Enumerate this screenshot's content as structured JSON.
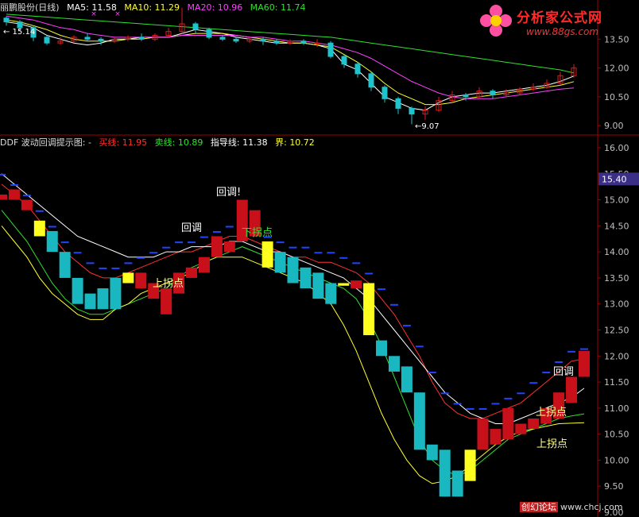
{
  "header_top": {
    "name": "丽鹏股份(日线)",
    "ma5_label": "MA5:",
    "ma5": "11.58",
    "ma10_label": "MA10:",
    "ma10": "11.29",
    "ma20_label": "MA20:",
    "ma20": "10.96",
    "ma60_label": "MA60:",
    "ma60": "11.74"
  },
  "header_bottom": {
    "name": "DDF 波动回调提示图: -",
    "buy_label": "买线:",
    "buy": "11.95",
    "sell_label": "卖线:",
    "sell": "10.89",
    "guide_label": "指导线:",
    "guide": "11.38",
    "bound_label": "界:",
    "bound": "10.72"
  },
  "logo": {
    "main": "分析家公式网",
    "sub": "www.88gs.com"
  },
  "watermark": {
    "a": "创幻论坛",
    "b": "www.chcj.com"
  },
  "colors": {
    "up": "#dd1b1b",
    "down": "#1ec3cc",
    "ma5": "#ffffff",
    "ma10": "#ffff30",
    "ma20": "#ff40ff",
    "ma60": "#30e030",
    "axis": "#a00000",
    "current_bg": "#3a2e86"
  },
  "chart_data": [
    {
      "type": "line",
      "panel": "price-candles",
      "ylim": [
        8.8,
        14.3
      ],
      "yticks": [
        "13.50",
        "12.00",
        "10.50",
        "9.00"
      ],
      "annotations": [
        "15.14",
        "9.07"
      ],
      "series": [
        {
          "name": "MA5",
          "values": [
            14.4,
            14.3,
            14.1,
            13.7,
            13.5,
            13.3,
            13.2,
            13.3,
            13.5,
            13.5,
            13.6,
            13.6,
            13.6,
            13.8,
            14.0,
            13.9,
            13.8,
            13.6,
            13.5,
            13.4,
            13.3,
            13.3,
            13.3,
            13.2,
            13.0,
            12.2,
            11.9,
            11.2,
            10.5,
            10.2,
            9.9,
            9.8,
            10.2,
            10.5,
            10.6,
            10.7,
            10.7,
            10.8,
            10.9,
            11.0,
            11.1,
            11.3,
            11.58
          ]
        },
        {
          "name": "MA10",
          "values": [
            14.5,
            14.4,
            14.2,
            14.0,
            13.7,
            13.5,
            13.4,
            13.4,
            13.4,
            13.5,
            13.5,
            13.6,
            13.6,
            13.7,
            13.8,
            13.8,
            13.8,
            13.7,
            13.6,
            13.5,
            13.4,
            13.3,
            13.3,
            13.2,
            13.1,
            12.7,
            12.3,
            11.8,
            11.2,
            10.7,
            10.4,
            10.1,
            10.1,
            10.2,
            10.4,
            10.5,
            10.6,
            10.7,
            10.8,
            10.9,
            11.0,
            11.1,
            11.29
          ]
        },
        {
          "name": "MA20",
          "values": [
            14.7,
            14.6,
            14.5,
            14.3,
            14.1,
            14.0,
            13.8,
            13.7,
            13.6,
            13.6,
            13.6,
            13.6,
            13.6,
            13.7,
            13.7,
            13.7,
            13.7,
            13.7,
            13.6,
            13.6,
            13.5,
            13.4,
            13.4,
            13.3,
            13.2,
            13.0,
            12.8,
            12.5,
            12.1,
            11.7,
            11.3,
            11.0,
            10.7,
            10.5,
            10.4,
            10.4,
            10.4,
            10.5,
            10.6,
            10.7,
            10.8,
            10.9,
            10.96
          ]
        },
        {
          "name": "MA60",
          "values": [
            14.8,
            14.75,
            14.7,
            14.65,
            14.6,
            14.55,
            14.5,
            14.45,
            14.4,
            14.35,
            14.3,
            14.25,
            14.2,
            14.15,
            14.1,
            14.05,
            14.0,
            13.95,
            13.9,
            13.85,
            13.8,
            13.75,
            13.7,
            13.65,
            13.6,
            13.5,
            13.4,
            13.3,
            13.2,
            13.1,
            13.0,
            12.9,
            12.8,
            12.7,
            12.6,
            12.5,
            12.4,
            12.3,
            12.2,
            12.1,
            12.0,
            11.9,
            11.74
          ]
        }
      ],
      "candles": [
        [
          14.6,
          14.4,
          14.7,
          14.2
        ],
        [
          14.4,
          14.1,
          14.5,
          13.9
        ],
        [
          14.1,
          13.6,
          14.2,
          13.4
        ],
        [
          13.6,
          13.3,
          13.7,
          13.2
        ],
        [
          13.3,
          13.4,
          13.6,
          13.2
        ],
        [
          13.4,
          13.6,
          13.7,
          13.3
        ],
        [
          13.6,
          13.5,
          13.8,
          13.4
        ],
        [
          13.5,
          13.4,
          13.6,
          13.2
        ],
        [
          13.4,
          13.5,
          13.6,
          13.3
        ],
        [
          13.5,
          13.6,
          13.7,
          13.4
        ],
        [
          13.6,
          13.5,
          13.8,
          13.4
        ],
        [
          13.5,
          13.7,
          13.8,
          13.4
        ],
        [
          13.7,
          13.9,
          14.1,
          13.6
        ],
        [
          13.9,
          14.3,
          15.14,
          13.8
        ],
        [
          14.3,
          14.0,
          14.4,
          13.8
        ],
        [
          14.0,
          13.6,
          14.1,
          13.5
        ],
        [
          13.6,
          13.5,
          13.7,
          13.4
        ],
        [
          13.5,
          13.4,
          13.6,
          13.3
        ],
        [
          13.4,
          13.5,
          13.6,
          13.3
        ],
        [
          13.5,
          13.4,
          13.6,
          13.2
        ],
        [
          13.4,
          13.3,
          13.5,
          13.2
        ],
        [
          13.3,
          13.4,
          13.5,
          13.2
        ],
        [
          13.4,
          13.3,
          13.5,
          13.2
        ],
        [
          13.3,
          13.3,
          13.5,
          13.1
        ],
        [
          13.3,
          12.6,
          13.4,
          12.5
        ],
        [
          12.6,
          12.2,
          12.7,
          12.0
        ],
        [
          12.2,
          11.7,
          12.3,
          11.5
        ],
        [
          11.7,
          11.0,
          11.8,
          10.8
        ],
        [
          11.0,
          10.4,
          11.1,
          10.2
        ],
        [
          10.4,
          9.9,
          10.5,
          9.6
        ],
        [
          9.9,
          9.6,
          10.0,
          9.07
        ],
        [
          9.6,
          9.8,
          10.0,
          9.3
        ],
        [
          9.8,
          10.3,
          10.5,
          9.7
        ],
        [
          10.3,
          10.6,
          10.8,
          10.2
        ],
        [
          10.6,
          10.5,
          10.7,
          10.3
        ],
        [
          10.5,
          10.8,
          11.0,
          10.4
        ],
        [
          10.8,
          10.6,
          10.9,
          10.4
        ],
        [
          10.6,
          10.7,
          10.9,
          10.5
        ],
        [
          10.7,
          10.9,
          11.0,
          10.6
        ],
        [
          10.9,
          11.0,
          11.2,
          10.8
        ],
        [
          11.0,
          11.2,
          11.4,
          10.9
        ],
        [
          11.2,
          11.6,
          11.8,
          11.1
        ],
        [
          11.6,
          12.0,
          12.2,
          11.5
        ]
      ]
    },
    {
      "type": "bar",
      "panel": "ddf-indicator",
      "ylim": [
        9.0,
        16.2
      ],
      "yticks": [
        "16.00",
        "15.50",
        "15.00",
        "14.50",
        "14.00",
        "13.50",
        "13.00",
        "12.50",
        "12.00",
        "11.50",
        "11.00",
        "10.50",
        "10.00",
        "9.50",
        "9.00"
      ],
      "current_value": "15.40",
      "annotations": [
        "回调!",
        "回调",
        "下拐点",
        "上拐点",
        "回调",
        "上拐点",
        "上拐点"
      ],
      "blocks": [
        {
          "c": "up",
          "v": [
            15.1,
            15.0
          ]
        },
        {
          "c": "up",
          "v": [
            15.2,
            15.0
          ]
        },
        {
          "c": "up",
          "v": [
            15.0,
            14.8
          ]
        },
        {
          "c": "yellow",
          "v": [
            14.6,
            14.3
          ]
        },
        {
          "c": "down",
          "v": [
            14.4,
            14.0
          ]
        },
        {
          "c": "down",
          "v": [
            14.0,
            13.5
          ]
        },
        {
          "c": "down",
          "v": [
            13.5,
            13.0
          ]
        },
        {
          "c": "down",
          "v": [
            13.2,
            12.9
          ]
        },
        {
          "c": "down",
          "v": [
            13.3,
            12.9
          ]
        },
        {
          "c": "down",
          "v": [
            13.5,
            12.9
          ]
        },
        {
          "c": "yellow",
          "v": [
            13.6,
            13.4
          ]
        },
        {
          "c": "up",
          "v": [
            13.6,
            13.3
          ]
        },
        {
          "c": "up",
          "v": [
            13.4,
            13.1
          ]
        },
        {
          "c": "up",
          "v": [
            13.3,
            12.8
          ]
        },
        {
          "c": "up",
          "v": [
            13.6,
            13.2
          ]
        },
        {
          "c": "up",
          "v": [
            13.7,
            13.5
          ]
        },
        {
          "c": "up",
          "v": [
            13.9,
            13.6
          ]
        },
        {
          "c": "up",
          "v": [
            14.3,
            13.9
          ]
        },
        {
          "c": "up",
          "v": [
            14.2,
            14.0
          ]
        },
        {
          "c": "up",
          "v": [
            15.0,
            14.2
          ]
        },
        {
          "c": "up",
          "v": [
            14.8,
            14.3
          ]
        },
        {
          "c": "yellow",
          "v": [
            14.2,
            13.7
          ]
        },
        {
          "c": "down",
          "v": [
            14.0,
            13.6
          ]
        },
        {
          "c": "down",
          "v": [
            13.9,
            13.4
          ]
        },
        {
          "c": "down",
          "v": [
            13.7,
            13.3
          ]
        },
        {
          "c": "down",
          "v": [
            13.6,
            13.1
          ]
        },
        {
          "c": "down",
          "v": [
            13.4,
            13.0
          ]
        },
        {
          "c": "yellow",
          "v": [
            13.4,
            13.35
          ]
        },
        {
          "c": "up",
          "v": [
            13.45,
            13.3
          ]
        },
        {
          "c": "yellow",
          "v": [
            13.4,
            12.4
          ]
        },
        {
          "c": "down",
          "v": [
            12.3,
            12.0
          ]
        },
        {
          "c": "down",
          "v": [
            12.0,
            11.7
          ]
        },
        {
          "c": "down",
          "v": [
            11.8,
            11.3
          ]
        },
        {
          "c": "down",
          "v": [
            11.3,
            10.2
          ]
        },
        {
          "c": "down",
          "v": [
            10.3,
            10.0
          ]
        },
        {
          "c": "down",
          "v": [
            10.2,
            9.3
          ]
        },
        {
          "c": "down",
          "v": [
            9.8,
            9.3
          ]
        },
        {
          "c": "yellow",
          "v": [
            10.2,
            9.6
          ]
        },
        {
          "c": "up",
          "v": [
            10.8,
            10.2
          ]
        },
        {
          "c": "up",
          "v": [
            10.6,
            10.3
          ]
        },
        {
          "c": "up",
          "v": [
            11.0,
            10.4
          ]
        },
        {
          "c": "up",
          "v": [
            10.7,
            10.5
          ]
        },
        {
          "c": "up",
          "v": [
            10.8,
            10.6
          ]
        },
        {
          "c": "up",
          "v": [
            11.0,
            10.7
          ]
        },
        {
          "c": "up",
          "v": [
            11.3,
            10.8
          ]
        },
        {
          "c": "up",
          "v": [
            11.6,
            11.1
          ]
        },
        {
          "c": "up",
          "v": [
            12.1,
            11.6
          ]
        }
      ],
      "series": [
        {
          "name": "买线",
          "values": [
            15.3,
            15.1,
            14.9,
            14.6,
            14.3,
            14.0,
            13.8,
            13.6,
            13.5,
            13.5,
            13.6,
            13.7,
            13.8,
            13.9,
            14.0,
            14.0,
            14.1,
            14.2,
            14.3,
            14.3,
            14.2,
            14.1,
            14.0,
            13.9,
            13.9,
            13.8,
            13.8,
            13.7,
            13.6,
            13.4,
            13.1,
            12.8,
            12.4,
            12.0,
            11.5,
            11.1,
            10.9,
            10.8,
            10.8,
            10.9,
            11.0,
            11.1,
            11.3,
            11.5,
            11.7,
            11.9,
            11.95
          ]
        },
        {
          "name": "卖线",
          "values": [
            14.8,
            14.5,
            14.2,
            13.8,
            13.4,
            13.1,
            12.9,
            12.8,
            12.8,
            12.9,
            13.0,
            13.1,
            13.2,
            13.3,
            13.5,
            13.7,
            13.8,
            13.9,
            14.0,
            14.1,
            14.0,
            13.9,
            13.8,
            13.7,
            13.6,
            13.5,
            13.4,
            13.3,
            13.1,
            12.7,
            12.2,
            11.6,
            11.0,
            10.4,
            10.0,
            9.8,
            9.7,
            9.8,
            10.0,
            10.2,
            10.4,
            10.5,
            10.6,
            10.7,
            10.8,
            10.85,
            10.89
          ]
        },
        {
          "name": "指导线",
          "values": [
            15.5,
            15.3,
            15.1,
            14.9,
            14.7,
            14.5,
            14.3,
            14.2,
            14.1,
            14.0,
            13.9,
            13.9,
            13.9,
            14.0,
            14.0,
            14.1,
            14.1,
            14.1,
            14.2,
            14.2,
            14.1,
            14.0,
            14.0,
            13.9,
            13.8,
            13.7,
            13.6,
            13.5,
            13.3,
            13.1,
            12.8,
            12.5,
            12.2,
            11.9,
            11.6,
            11.3,
            11.1,
            10.9,
            10.8,
            10.7,
            10.7,
            10.8,
            10.9,
            11.0,
            11.1,
            11.2,
            11.38
          ]
        },
        {
          "name": "界",
          "values": [
            14.5,
            14.2,
            13.9,
            13.5,
            13.2,
            13.0,
            12.8,
            12.7,
            12.7,
            12.9,
            13.0,
            13.2,
            13.3,
            13.4,
            13.5,
            13.6,
            13.8,
            13.9,
            13.9,
            13.9,
            13.8,
            13.7,
            13.6,
            13.5,
            13.4,
            13.2,
            13.0,
            12.6,
            12.1,
            11.5,
            10.9,
            10.4,
            10.0,
            9.7,
            9.55,
            9.6,
            9.7,
            9.9,
            10.1,
            10.3,
            10.45,
            10.55,
            10.6,
            10.65,
            10.7,
            10.71,
            10.72
          ]
        }
      ]
    }
  ]
}
